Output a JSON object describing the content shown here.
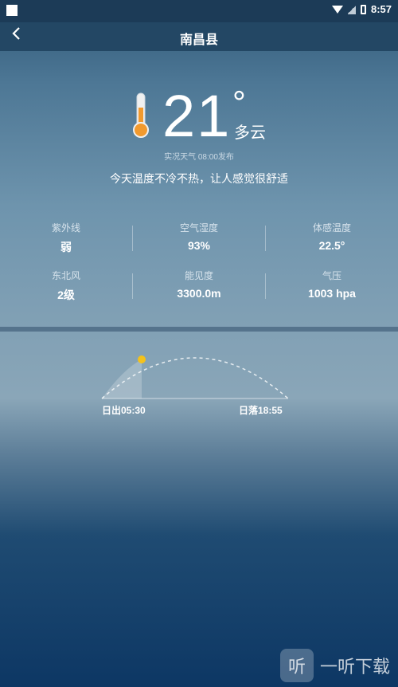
{
  "status": {
    "time": "8:57"
  },
  "header": {
    "title": "南昌县"
  },
  "current": {
    "temperature": "21",
    "degree": "°",
    "condition": "多云",
    "published": "实况天气 08:00发布",
    "description": "今天温度不冷不热，让人感觉很舒适"
  },
  "details": [
    {
      "label": "紫外线",
      "value": "弱"
    },
    {
      "label": "空气湿度",
      "value": "93%"
    },
    {
      "label": "体感温度",
      "value": "22.5°"
    },
    {
      "label": "东北风",
      "value": "2级"
    },
    {
      "label": "能见度",
      "value": "3300.0m"
    },
    {
      "label": "气压",
      "value": "1003 hpa"
    }
  ],
  "sun": {
    "sunrise": "日出05:30",
    "sunset": "日落18:55"
  },
  "watermark": {
    "text": "一听下载",
    "logo": "听"
  }
}
